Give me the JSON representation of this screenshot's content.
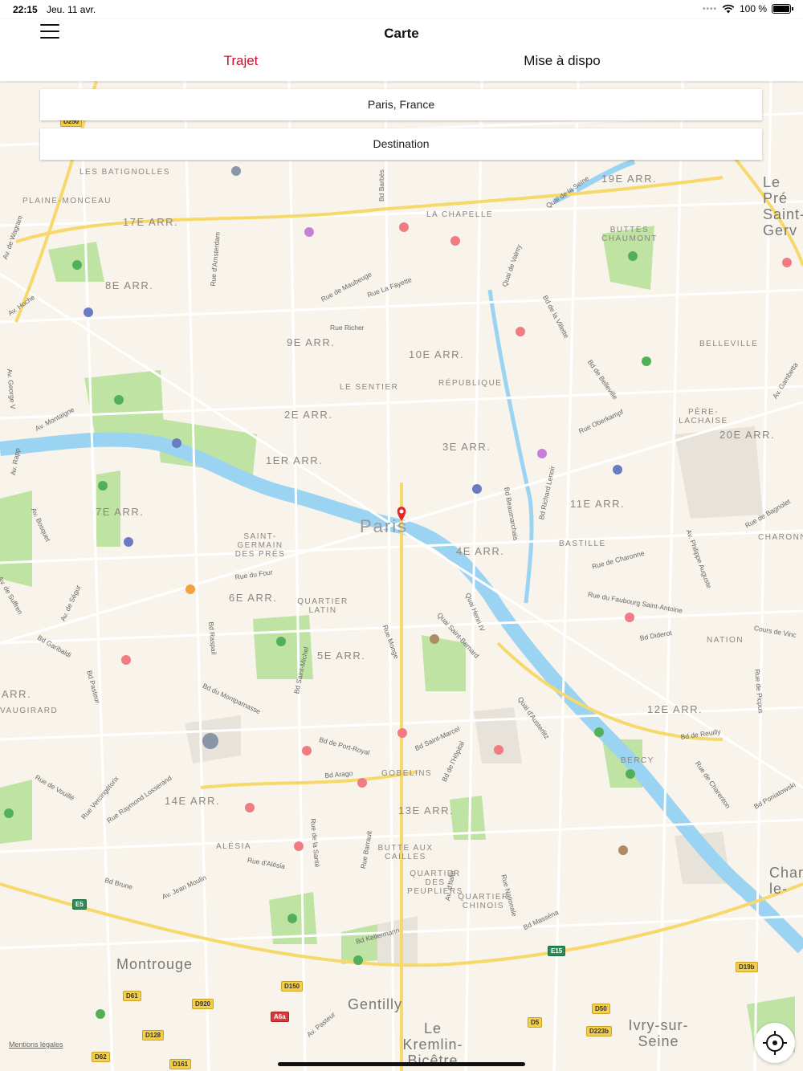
{
  "status_bar": {
    "time": "22:15",
    "date": "Jeu. 11 avr.",
    "battery": "100 %"
  },
  "nav": {
    "title": "Carte",
    "tabs": [
      {
        "label": "Trajet"
      },
      {
        "label": "Mise à dispo"
      }
    ]
  },
  "origin_field": {
    "value": "Paris, France"
  },
  "destination_field": {
    "value": "Destination"
  },
  "map": {
    "city_label": "Paris",
    "legal": "Mentions légales",
    "districts": [
      "17E ARR.",
      "8E ARR.",
      "9E ARR.",
      "10E ARR.",
      "19E ARR.",
      "2E ARR.",
      "3E ARR.",
      "1ER ARR.",
      "7E ARR.",
      "11E ARR.",
      "4E ARR.",
      "6E ARR.",
      "5E ARR.",
      "20E ARR.",
      "12E ARR.",
      "14E ARR.",
      "13E ARR.",
      "ARR."
    ],
    "neighborhoods": [
      "LES BATIGNOLLES",
      "PLAINE-MONCEAU",
      "LA CHAPELLE",
      "BUTTES CHAUMONT",
      "BELLEVILLE",
      "LE SENTIER",
      "RÉPUBLIQUE",
      "PÈRE-LACHAISE",
      "SAINT-GERMAIN DES PRÉS",
      "BASTILLE",
      "CHARONN",
      "QUARTIER LATIN",
      "NATION",
      "BERCY",
      "GOBELINS",
      "ALÉSIA",
      "BUTTE AUX CAILLES",
      "QUARTIER DES PEUPLIERS",
      "QUARTIER CHINOIS",
      "VAUGIRARD"
    ],
    "towns": [
      "Montrouge",
      "Gentilly",
      "Le Kremlin-Bicêtre",
      "Ivry-sur-Seine",
      "Le Pré Saint-Gerv",
      "Char le-"
    ],
    "streets": [
      "Bd Barbès",
      "Quai de la Seine",
      "Rue de Maubeuge",
      "Rue La Fayette",
      "Quai de Valmy",
      "Bd de la Villette",
      "Bd de Belleville",
      "Rue Richer",
      "Rue Oberkampf",
      "Av. Gambetta",
      "Bd Beaumarchais",
      "Bd Richard Lenoir",
      "Rue de Charonne",
      "Rue du Faubourg Saint-Antoine",
      "Bd Diderot",
      "Av. Philippe Auguste",
      "Quai Henri IV",
      "Quai Saint-Bernard",
      "Quai d'Austerlitz",
      "Rue du Four",
      "Bd Raspail",
      "Bd Saint-Michel",
      "Rue Monge",
      "Bd Garibaldi",
      "Bd Pasteur",
      "Bd du Montparnasse",
      "Bd de Port-Royal",
      "Bd Saint-Marcel",
      "Bd de l'Hôpital",
      "Bd Arago",
      "Rue de Vouillé",
      "Rue Raymond Losserand",
      "Rue d'Alésia",
      "Bd Brune",
      "Av. Jean Moulin",
      "Bd Kellermann",
      "Bd Masséna",
      "Bd de Reuilly",
      "Bd Poniatowski",
      "Rue de Charenton",
      "Cours de Vinc",
      "Av. d'Italie",
      "Rue Nationale",
      "Rue Barrault",
      "Rue de la Santé",
      "Av. Montaigne",
      "Rue d'Amsterdam",
      "Av. de Wagram",
      "Av. Hoche",
      "Av. George V",
      "Av. Rapp",
      "Av. Bosquet",
      "Av. de Suffren",
      "Av. de Ségur",
      "Rue Vercingétorix",
      "Av. Pasteur",
      "Rue de Picpus",
      "Rue de Bagnolet"
    ],
    "route_shields": [
      "D250",
      "E5",
      "D150",
      "D61",
      "D920",
      "A6a",
      "D128",
      "D62",
      "D161",
      "E15",
      "D50",
      "D19b",
      "D5",
      "D223b"
    ]
  }
}
